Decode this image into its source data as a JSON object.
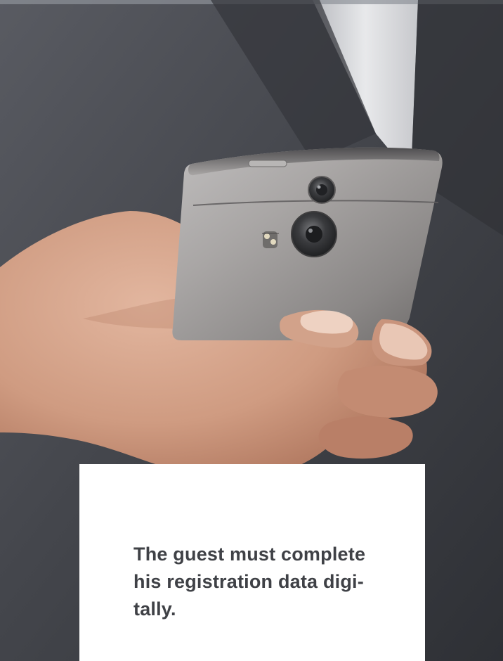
{
  "caption": {
    "lines": [
      "The guest must complete",
      "his registration data digi-",
      "tally."
    ]
  },
  "colors": {
    "suit": "#3d3f45",
    "shirt": "#d9dadd",
    "phone": "#8f8d8c",
    "skin": "#d4a287",
    "card": "#ffffff",
    "text": "#3f4146"
  },
  "image": {
    "subject": "hand-holding-smartphone",
    "icons": [
      "camera-icon",
      "flash-icon",
      "speaker-grille-icon"
    ]
  }
}
